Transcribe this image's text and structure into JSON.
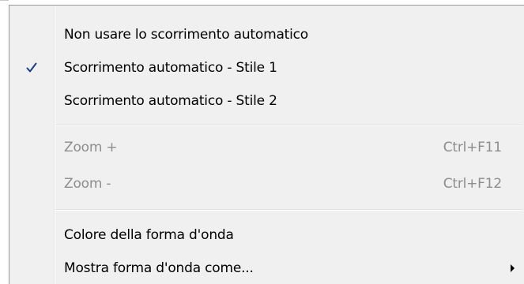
{
  "menu": {
    "items": [
      {
        "label": "Non usare lo scorrimento automatico",
        "shortcut": "",
        "checked": false,
        "disabled": false,
        "submenu": false
      },
      {
        "label": "Scorrimento automatico - Stile 1",
        "shortcut": "",
        "checked": true,
        "disabled": false,
        "submenu": false
      },
      {
        "label": "Scorrimento automatico - Stile 2",
        "shortcut": "",
        "checked": false,
        "disabled": false,
        "submenu": false
      },
      {
        "label": "Zoom +",
        "shortcut": "Ctrl+F11",
        "checked": false,
        "disabled": true,
        "submenu": false
      },
      {
        "label": "Zoom -",
        "shortcut": "Ctrl+F12",
        "checked": false,
        "disabled": true,
        "submenu": false
      },
      {
        "label": "Colore della forma d'onda",
        "shortcut": "",
        "checked": false,
        "disabled": false,
        "submenu": false
      },
      {
        "label": "Mostra forma d'onda come...",
        "shortcut": "",
        "checked": false,
        "disabled": false,
        "submenu": true
      }
    ]
  },
  "colors": {
    "menu_background": "#f0f0f0",
    "disabled_text": "#8d8d8d",
    "check_mark": "#1a3d8c"
  },
  "icons": {
    "check": "check-mark-icon",
    "submenu": "submenu-arrow-icon"
  }
}
